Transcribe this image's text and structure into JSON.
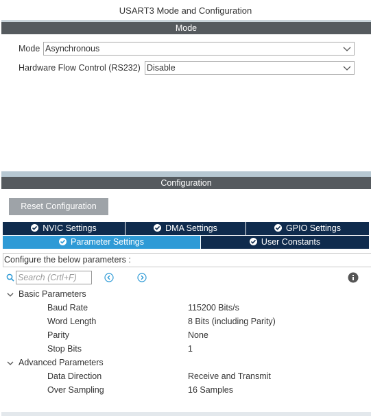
{
  "window": {
    "title": "USART3 Mode and Configuration"
  },
  "mode_section": {
    "header": "Mode",
    "fields": [
      {
        "label": "Mode",
        "value": "Asynchronous"
      },
      {
        "label": "Hardware Flow Control (RS232)",
        "value": "Disable"
      }
    ]
  },
  "config_section": {
    "header": "Configuration",
    "reset_button": "Reset Configuration",
    "tabs_row1": [
      {
        "label": "NVIC Settings"
      },
      {
        "label": "DMA Settings"
      },
      {
        "label": "GPIO Settings"
      }
    ],
    "tabs_row2": [
      {
        "label": "Parameter Settings",
        "active": true
      },
      {
        "label": "User Constants",
        "active": false
      }
    ],
    "hint": "Configure the below parameters :",
    "search": {
      "placeholder": "Search (Crtl+F)"
    },
    "groups": [
      {
        "name": "Basic Parameters",
        "params": [
          {
            "name": "Baud Rate",
            "value": "115200 Bits/s"
          },
          {
            "name": "Word Length",
            "value": "8 Bits (including Parity)"
          },
          {
            "name": "Parity",
            "value": "None"
          },
          {
            "name": "Stop Bits",
            "value": "1"
          }
        ]
      },
      {
        "name": "Advanced Parameters",
        "params": [
          {
            "name": "Data Direction",
            "value": "Receive and Transmit"
          },
          {
            "name": "Over Sampling",
            "value": "16 Samples"
          }
        ]
      }
    ]
  },
  "colors": {
    "header_bg": "#555a5e",
    "tab_bg": "#0f2b4d",
    "tab_active_bg": "#2e9ad6",
    "reset_bg": "#9ea3a8",
    "icon_blue": "#2e9ad6"
  }
}
